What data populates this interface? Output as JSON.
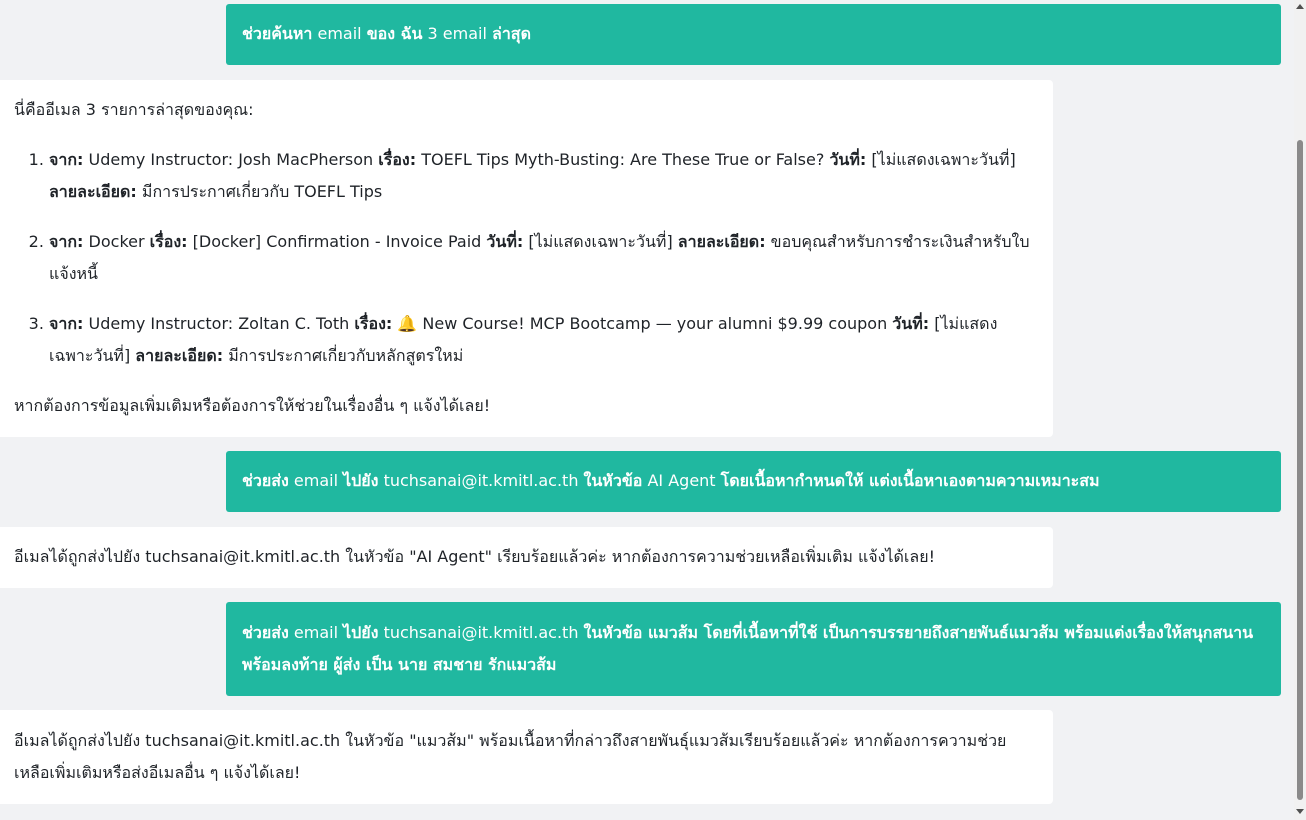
{
  "messages": {
    "m1": {
      "a": "ช่วยค้นหา",
      "b": " email ",
      "c": "ของ ฉัน",
      "d": " 3 email ",
      "e": "ล่าสุด"
    },
    "m2": {
      "intro": "นี่คืออีเมล 3 รายการล่าสุดของคุณ:",
      "items": [
        {
          "from_label": "จาก:",
          "from": " Udemy Instructor: Josh MacPherson ",
          "subject_label": "เรื่อง:",
          "subject": " TOEFL Tips Myth-Busting: Are These True or False? ",
          "date_label": "วันที่:",
          "date": " [ไม่แสดงเฉพาะวันที่] ",
          "detail_label": "ลายละเอียด:",
          "detail": " มีการประกาศเกี่ยวกับ TOEFL Tips"
        },
        {
          "from_label": "จาก:",
          "from": " Docker ",
          "subject_label": "เรื่อง:",
          "subject": " [Docker] Confirmation - Invoice Paid ",
          "date_label": "วันที่:",
          "date": " [ไม่แสดงเฉพาะวันที่] ",
          "detail_label": "ลายละเอียด:",
          "detail": " ขอบคุณสำหรับการชำระเงินสำหรับใบแจ้งหนี้"
        },
        {
          "from_label": "จาก:",
          "from": " Udemy Instructor: Zoltan C. Toth ",
          "subject_label": "เรื่อง:",
          "subject": " 🔔 New Course! MCP Bootcamp — your alumni $9.99 coupon ",
          "date_label": "วันที่:",
          "date": " [ไม่แสดงเฉพาะวันที่] ",
          "detail_label": "ลายละเอียด:",
          "detail": " มีการประกาศเกี่ยวกับหลักสูตรใหม่"
        }
      ],
      "outro": "หากต้องการข้อมูลเพิ่มเติมหรือต้องการให้ช่วยในเรื่องอื่น ๆ แจ้งได้เลย!"
    },
    "m3": {
      "a": "ช่วยส่ง",
      "b": " email ",
      "c": "ไปยัง",
      "d": " tuchsanai@it.kmitl.ac.th ",
      "e": "ในหัวข้อ",
      "f": " AI Agent ",
      "g": "โดยเนื้อหากำหนดให้ แต่งเนื้อหาเองตามความเหมาะสม"
    },
    "m4": {
      "text": "อีเมลได้ถูกส่งไปยัง tuchsanai@it.kmitl.ac.th ในหัวข้อ \"AI Agent\" เรียบร้อยแล้วค่ะ หากต้องการความช่วยเหลือเพิ่มเติม แจ้งได้เลย!"
    },
    "m5": {
      "a": "ช่วยส่ง",
      "b": " email ",
      "c": "ไปยัง",
      "d": " tuchsanai@it.kmitl.ac.th ",
      "e": "ในหัวข้อ แมวส้ม โดยที่เนื้อหาที่ใช้ เป็นการบรรยายถึงสายพันธ์แมวส้ม พร้อมแต่งเรื่องให้สนุกสนาน พร้อมลงท้าย ผู้ส่ง เป็น นาย สมชาย รักแมวส้ม"
    },
    "m6": {
      "text": "อีเมลได้ถูกส่งไปยัง tuchsanai@it.kmitl.ac.th ในหัวข้อ \"แมวส้ม\" พร้อมเนื้อหาที่กล่าวถึงสายพันธุ์แมวส้มเรียบร้อยแล้วค่ะ หากต้องการความช่วยเหลือเพิ่มเติมหรือส่งอีเมลอื่น ๆ แจ้งได้เลย!"
    }
  },
  "colors": {
    "user_bubble": "#20b8a0",
    "bot_bubble": "#ffffff",
    "background": "#f1f2f4"
  }
}
